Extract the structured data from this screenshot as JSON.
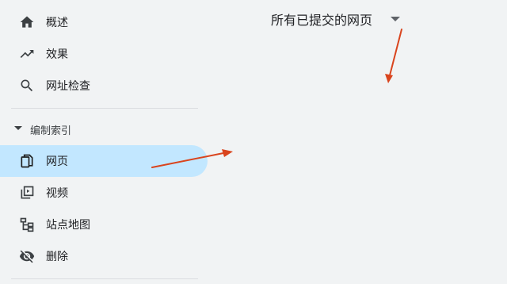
{
  "sidebar": {
    "items": [
      {
        "label": "概述",
        "icon": "home-icon"
      },
      {
        "label": "效果",
        "icon": "trending-up-icon"
      },
      {
        "label": "网址检查",
        "icon": "search-icon"
      }
    ],
    "section": {
      "label": "编制索引",
      "items": [
        {
          "label": "网页",
          "icon": "pages-icon",
          "active": true
        },
        {
          "label": "视频",
          "icon": "video-pages-icon"
        },
        {
          "label": "站点地图",
          "icon": "sitemap-icon"
        },
        {
          "label": "删除",
          "icon": "visibility-off-icon"
        }
      ]
    }
  },
  "main": {
    "dropdown": {
      "label": "所有已提交的网页"
    }
  },
  "colors": {
    "background": "#f1f3f4",
    "active_item": "#c2e7ff",
    "annotation_arrow": "#d9441d"
  }
}
